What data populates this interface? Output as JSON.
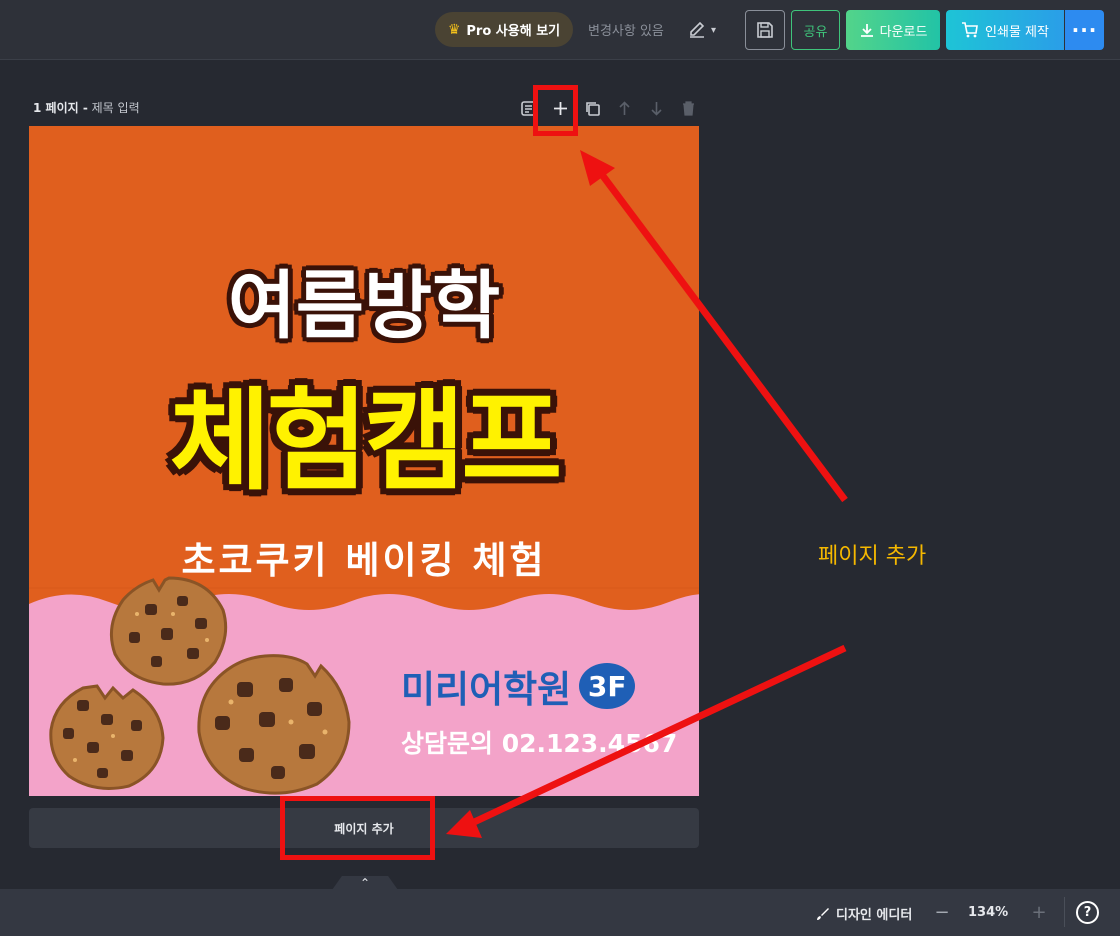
{
  "topbar": {
    "pro_label": "Pro 사용해 보기",
    "changes_label": "변경사항 있음",
    "share_label": "공유",
    "download_label": "다운로드",
    "print_label": "인쇄물 제작",
    "more_label": "···"
  },
  "page": {
    "number_label": "1 페이지 -",
    "title_placeholder": "제목 입력"
  },
  "poster": {
    "title1": "여름방학",
    "title2": "체험캠프",
    "subtitle": "초코쿠키 베이킹 체험",
    "academy": "미리어학원",
    "floor": "3F",
    "contact": "상담문의 02.123.4567"
  },
  "add_page_label": "페이지 추가",
  "annotation_label": "페이지 추가",
  "bottombar": {
    "editor_mode_label": "디자인 에디터",
    "zoom_minus": "−",
    "zoom_value": "134%",
    "zoom_plus": "+",
    "help": "?"
  },
  "colors": {
    "canvas_orange": "#e05f1e",
    "canvas_pink": "#f3a3c9",
    "title_yellow": "#fff200",
    "academy_blue": "#1f5fb6",
    "highlight_red": "#ee1111",
    "annotation_yellow": "#f5b800"
  }
}
